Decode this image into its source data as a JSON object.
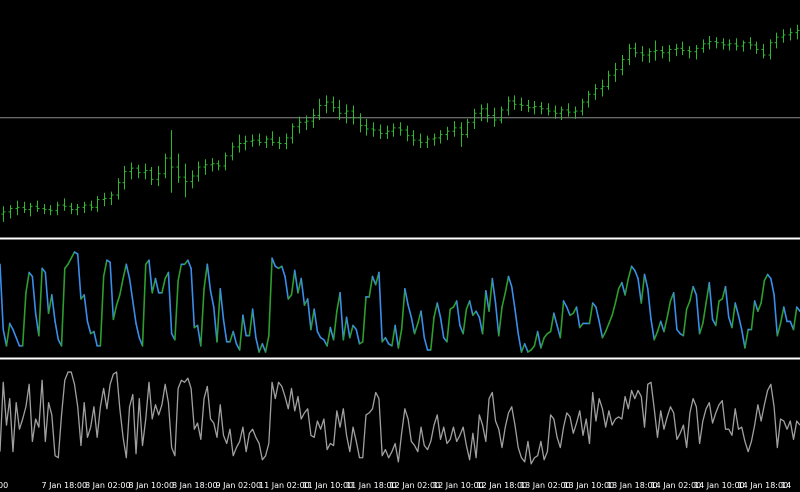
{
  "colors": {
    "background": "#000000",
    "bar_color": "#2eb82e",
    "indicator_up": "#2e9e2e",
    "indicator_down": "#3a8eea",
    "indicator2_line": "#a0a0a0",
    "level_line": "#8c8c8c",
    "separator": "#ffffff",
    "axis_text": "#ffffff"
  },
  "chart_data": [
    {
      "type": "ohlc",
      "panel": "price",
      "grid": false,
      "ylim": [
        0,
        100
      ],
      "horizontal_level": 51.0,
      "bars": [
        {
          "o": 8.0,
          "h": 11.5,
          "l": 4.5,
          "c": 9.0
        },
        {
          "o": 9.0,
          "h": 12.0,
          "l": 6.0,
          "c": 10.5
        },
        {
          "o": 10.5,
          "h": 14.0,
          "l": 7.5,
          "c": 11.0
        },
        {
          "o": 11.0,
          "h": 13.5,
          "l": 8.5,
          "c": 10.0
        },
        {
          "o": 10.0,
          "h": 13.0,
          "l": 7.0,
          "c": 11.5
        },
        {
          "o": 11.5,
          "h": 14.0,
          "l": 9.0,
          "c": 10.5
        },
        {
          "o": 10.5,
          "h": 12.5,
          "l": 8.0,
          "c": 10.0
        },
        {
          "o": 10.0,
          "h": 12.0,
          "l": 7.5,
          "c": 9.5
        },
        {
          "o": 9.5,
          "h": 13.5,
          "l": 7.5,
          "c": 12.0
        },
        {
          "o": 12.0,
          "h": 15.0,
          "l": 9.5,
          "c": 11.5
        },
        {
          "o": 11.5,
          "h": 13.0,
          "l": 8.0,
          "c": 10.0
        },
        {
          "o": 10.0,
          "h": 12.5,
          "l": 7.5,
          "c": 11.0
        },
        {
          "o": 11.0,
          "h": 13.5,
          "l": 8.5,
          "c": 12.0
        },
        {
          "o": 12.0,
          "h": 14.0,
          "l": 9.5,
          "c": 11.0
        },
        {
          "o": 11.0,
          "h": 16.0,
          "l": 9.0,
          "c": 14.5
        },
        {
          "o": 14.5,
          "h": 17.5,
          "l": 11.5,
          "c": 15.0
        },
        {
          "o": 15.0,
          "h": 18.0,
          "l": 12.0,
          "c": 16.5
        },
        {
          "o": 16.5,
          "h": 24.0,
          "l": 14.5,
          "c": 22.0
        },
        {
          "o": 22.0,
          "h": 29.5,
          "l": 19.0,
          "c": 27.0
        },
        {
          "o": 27.0,
          "h": 31.0,
          "l": 23.5,
          "c": 28.5
        },
        {
          "o": 28.5,
          "h": 30.0,
          "l": 24.0,
          "c": 26.5
        },
        {
          "o": 26.5,
          "h": 30.5,
          "l": 23.5,
          "c": 27.5
        },
        {
          "o": 27.5,
          "h": 29.0,
          "l": 21.0,
          "c": 23.5
        },
        {
          "o": 23.5,
          "h": 29.5,
          "l": 20.5,
          "c": 26.0
        },
        {
          "o": 26.0,
          "h": 35.0,
          "l": 24.0,
          "c": 33.0
        },
        {
          "o": 33.0,
          "h": 45.5,
          "l": 17.5,
          "c": 29.0
        },
        {
          "o": 29.0,
          "h": 35.0,
          "l": 22.0,
          "c": 24.5
        },
        {
          "o": 24.5,
          "h": 30.5,
          "l": 15.5,
          "c": 22.5
        },
        {
          "o": 22.5,
          "h": 27.5,
          "l": 19.5,
          "c": 25.0
        },
        {
          "o": 25.0,
          "h": 31.5,
          "l": 22.5,
          "c": 29.0
        },
        {
          "o": 29.0,
          "h": 32.5,
          "l": 25.5,
          "c": 30.0
        },
        {
          "o": 30.0,
          "h": 33.0,
          "l": 27.0,
          "c": 30.5
        },
        {
          "o": 30.5,
          "h": 32.0,
          "l": 27.5,
          "c": 29.5
        },
        {
          "o": 29.5,
          "h": 35.5,
          "l": 27.5,
          "c": 34.0
        },
        {
          "o": 34.0,
          "h": 40.0,
          "l": 32.0,
          "c": 38.0
        },
        {
          "o": 38.0,
          "h": 43.5,
          "l": 35.5,
          "c": 39.5
        },
        {
          "o": 39.5,
          "h": 43.0,
          "l": 36.5,
          "c": 40.5
        },
        {
          "o": 40.5,
          "h": 43.5,
          "l": 38.0,
          "c": 41.0
        },
        {
          "o": 41.0,
          "h": 44.0,
          "l": 38.5,
          "c": 40.0
        },
        {
          "o": 40.0,
          "h": 43.0,
          "l": 37.5,
          "c": 41.5
        },
        {
          "o": 41.5,
          "h": 45.0,
          "l": 38.5,
          "c": 40.0
        },
        {
          "o": 40.0,
          "h": 42.5,
          "l": 37.0,
          "c": 39.5
        },
        {
          "o": 39.5,
          "h": 44.0,
          "l": 37.0,
          "c": 42.0
        },
        {
          "o": 42.0,
          "h": 48.5,
          "l": 39.5,
          "c": 47.0
        },
        {
          "o": 47.0,
          "h": 51.5,
          "l": 44.0,
          "c": 49.0
        },
        {
          "o": 49.0,
          "h": 52.0,
          "l": 45.5,
          "c": 49.5
        },
        {
          "o": 49.5,
          "h": 55.0,
          "l": 46.5,
          "c": 52.0
        },
        {
          "o": 52.0,
          "h": 59.5,
          "l": 50.0,
          "c": 56.5
        },
        {
          "o": 56.5,
          "h": 61.0,
          "l": 53.0,
          "c": 58.0
        },
        {
          "o": 58.0,
          "h": 60.5,
          "l": 53.5,
          "c": 55.5
        },
        {
          "o": 55.5,
          "h": 59.0,
          "l": 50.0,
          "c": 53.0
        },
        {
          "o": 53.0,
          "h": 57.0,
          "l": 48.5,
          "c": 54.0
        },
        {
          "o": 54.0,
          "h": 56.5,
          "l": 48.0,
          "c": 51.0
        },
        {
          "o": 51.0,
          "h": 53.0,
          "l": 44.5,
          "c": 47.5
        },
        {
          "o": 47.5,
          "h": 50.5,
          "l": 43.0,
          "c": 46.0
        },
        {
          "o": 46.0,
          "h": 49.0,
          "l": 42.5,
          "c": 45.5
        },
        {
          "o": 45.5,
          "h": 48.0,
          "l": 41.5,
          "c": 44.0
        },
        {
          "o": 44.0,
          "h": 47.5,
          "l": 41.5,
          "c": 45.0
        },
        {
          "o": 45.0,
          "h": 48.5,
          "l": 42.5,
          "c": 46.5
        },
        {
          "o": 46.5,
          "h": 49.0,
          "l": 43.0,
          "c": 45.5
        },
        {
          "o": 45.5,
          "h": 47.5,
          "l": 40.5,
          "c": 43.0
        },
        {
          "o": 43.0,
          "h": 45.5,
          "l": 38.5,
          "c": 41.0
        },
        {
          "o": 41.0,
          "h": 44.0,
          "l": 37.5,
          "c": 40.0
        },
        {
          "o": 40.0,
          "h": 43.0,
          "l": 37.5,
          "c": 41.5
        },
        {
          "o": 41.5,
          "h": 44.0,
          "l": 38.5,
          "c": 42.0
        },
        {
          "o": 42.0,
          "h": 45.5,
          "l": 39.5,
          "c": 43.5
        },
        {
          "o": 43.5,
          "h": 47.0,
          "l": 41.0,
          "c": 45.0
        },
        {
          "o": 45.0,
          "h": 49.5,
          "l": 42.5,
          "c": 46.5
        },
        {
          "o": 46.5,
          "h": 49.0,
          "l": 38.0,
          "c": 43.5
        },
        {
          "o": 43.5,
          "h": 50.5,
          "l": 42.0,
          "c": 49.0
        },
        {
          "o": 49.0,
          "h": 55.0,
          "l": 46.0,
          "c": 53.0
        },
        {
          "o": 53.0,
          "h": 57.0,
          "l": 49.5,
          "c": 55.0
        },
        {
          "o": 55.0,
          "h": 57.5,
          "l": 49.0,
          "c": 52.0
        },
        {
          "o": 52.0,
          "h": 55.5,
          "l": 47.0,
          "c": 50.0
        },
        {
          "o": 50.0,
          "h": 56.0,
          "l": 48.5,
          "c": 54.5
        },
        {
          "o": 54.5,
          "h": 60.5,
          "l": 52.0,
          "c": 58.5
        },
        {
          "o": 58.5,
          "h": 61.0,
          "l": 54.5,
          "c": 57.0
        },
        {
          "o": 57.0,
          "h": 60.0,
          "l": 54.0,
          "c": 56.5
        },
        {
          "o": 56.5,
          "h": 59.0,
          "l": 53.5,
          "c": 55.5
        },
        {
          "o": 55.5,
          "h": 58.5,
          "l": 52.5,
          "c": 56.0
        },
        {
          "o": 56.0,
          "h": 58.0,
          "l": 52.5,
          "c": 55.0
        },
        {
          "o": 55.0,
          "h": 57.5,
          "l": 52.0,
          "c": 54.0
        },
        {
          "o": 54.0,
          "h": 56.5,
          "l": 50.5,
          "c": 53.0
        },
        {
          "o": 53.0,
          "h": 56.0,
          "l": 50.0,
          "c": 54.5
        },
        {
          "o": 54.5,
          "h": 57.5,
          "l": 51.5,
          "c": 53.5
        },
        {
          "o": 53.5,
          "h": 56.0,
          "l": 50.5,
          "c": 54.0
        },
        {
          "o": 54.0,
          "h": 59.5,
          "l": 52.0,
          "c": 58.0
        },
        {
          "o": 58.0,
          "h": 63.0,
          "l": 55.5,
          "c": 61.5
        },
        {
          "o": 61.5,
          "h": 66.0,
          "l": 59.0,
          "c": 64.0
        },
        {
          "o": 64.0,
          "h": 68.0,
          "l": 60.5,
          "c": 65.0
        },
        {
          "o": 65.0,
          "h": 72.0,
          "l": 63.5,
          "c": 70.0
        },
        {
          "o": 70.0,
          "h": 75.5,
          "l": 67.0,
          "c": 72.5
        },
        {
          "o": 72.5,
          "h": 79.0,
          "l": 70.0,
          "c": 77.0
        },
        {
          "o": 77.0,
          "h": 84.0,
          "l": 74.5,
          "c": 82.0
        },
        {
          "o": 82.0,
          "h": 84.5,
          "l": 78.0,
          "c": 80.0
        },
        {
          "o": 80.0,
          "h": 83.0,
          "l": 76.0,
          "c": 79.0
        },
        {
          "o": 79.0,
          "h": 82.0,
          "l": 75.5,
          "c": 80.5
        },
        {
          "o": 80.5,
          "h": 85.5,
          "l": 76.5,
          "c": 81.0
        },
        {
          "o": 81.0,
          "h": 83.0,
          "l": 77.5,
          "c": 80.0
        },
        {
          "o": 80.0,
          "h": 83.5,
          "l": 76.0,
          "c": 81.5
        },
        {
          "o": 81.5,
          "h": 84.0,
          "l": 78.5,
          "c": 82.0
        },
        {
          "o": 82.0,
          "h": 85.0,
          "l": 79.0,
          "c": 81.0
        },
        {
          "o": 81.0,
          "h": 83.0,
          "l": 77.5,
          "c": 80.5
        },
        {
          "o": 80.5,
          "h": 83.5,
          "l": 77.0,
          "c": 82.0
        },
        {
          "o": 82.0,
          "h": 86.0,
          "l": 80.0,
          "c": 84.0
        },
        {
          "o": 84.0,
          "h": 87.5,
          "l": 81.5,
          "c": 85.0
        },
        {
          "o": 85.0,
          "h": 87.0,
          "l": 82.0,
          "c": 84.5
        },
        {
          "o": 84.5,
          "h": 86.5,
          "l": 81.5,
          "c": 83.5
        },
        {
          "o": 83.5,
          "h": 86.0,
          "l": 81.0,
          "c": 84.0
        },
        {
          "o": 84.0,
          "h": 86.5,
          "l": 81.0,
          "c": 83.0
        },
        {
          "o": 83.0,
          "h": 85.5,
          "l": 80.5,
          "c": 84.5
        },
        {
          "o": 84.5,
          "h": 87.0,
          "l": 81.5,
          "c": 83.5
        },
        {
          "o": 83.5,
          "h": 85.0,
          "l": 79.5,
          "c": 81.5
        },
        {
          "o": 81.5,
          "h": 84.0,
          "l": 77.5,
          "c": 79.0
        },
        {
          "o": 79.0,
          "h": 86.0,
          "l": 77.0,
          "c": 84.5
        },
        {
          "o": 84.5,
          "h": 89.0,
          "l": 82.0,
          "c": 87.0
        },
        {
          "o": 87.0,
          "h": 90.5,
          "l": 84.5,
          "c": 88.0
        },
        {
          "o": 88.0,
          "h": 91.0,
          "l": 85.5,
          "c": 89.0
        },
        {
          "o": 89.0,
          "h": 92.5,
          "l": 86.0,
          "c": 90.0
        }
      ]
    },
    {
      "type": "line",
      "panel": "indicator",
      "ylim": [
        0,
        100
      ],
      "colored_by_direction": true,
      "values": [
        86,
        22,
        6,
        28,
        22,
        14,
        6,
        6,
        58,
        78,
        74,
        38,
        16,
        82,
        78,
        38,
        56,
        30,
        12,
        6,
        82,
        86,
        92,
        98,
        96,
        52,
        56,
        30,
        18,
        20,
        6,
        6,
        74,
        90,
        88,
        32,
        46,
        56,
        72,
        86,
        72,
        50,
        28,
        14,
        6,
        86,
        90,
        58,
        72,
        58,
        58,
        72,
        78,
        18,
        12,
        70,
        86,
        86,
        90,
        82,
        24,
        26,
        6,
        62,
        86,
        60,
        44,
        10,
        62,
        32,
        10,
        10,
        20,
        8,
        2,
        36,
        16,
        16,
        42,
        14,
        0,
        8,
        0,
        16,
        92,
        84,
        82,
        84,
        74,
        52,
        56,
        80,
        58,
        72,
        46,
        52,
        22,
        42,
        20,
        14,
        12,
        6,
        24,
        12,
        40,
        58,
        12,
        34,
        14,
        26,
        22,
        8,
        10,
        54,
        54,
        74,
        66,
        78,
        10,
        14,
        8,
        6,
        26,
        4,
        22,
        62,
        46,
        34,
        18,
        28,
        40,
        14,
        2,
        2,
        34,
        48,
        34,
        14,
        10,
        42,
        44,
        50,
        26,
        18,
        42,
        50,
        36,
        40,
        34,
        18,
        60,
        40,
        72,
        48,
        16,
        44,
        58,
        74,
        64,
        42,
        18,
        0,
        8,
        0,
        2,
        6,
        20,
        4,
        14,
        18,
        20,
        38,
        26,
        14,
        50,
        44,
        36,
        38,
        44,
        24,
        28,
        28,
        28,
        48,
        44,
        30,
        14,
        20,
        28,
        36,
        48,
        62,
        68,
        56,
        72,
        84,
        80,
        72,
        48,
        76,
        62,
        32,
        12,
        20,
        30,
        20,
        34,
        50,
        58,
        22,
        18,
        16,
        42,
        50,
        64,
        56,
        18,
        28,
        48,
        68,
        32,
        26,
        50,
        52,
        64,
        34,
        24,
        48,
        36,
        22,
        4,
        22,
        22,
        50,
        40,
        48,
        70,
        76,
        72,
        56,
        16,
        28,
        44,
        30,
        30,
        22,
        44,
        40
      ]
    },
    {
      "type": "line",
      "panel": "indicator2",
      "ylim": [
        0,
        100
      ],
      "values": [
        18,
        86,
        44,
        70,
        18,
        66,
        40,
        50,
        62,
        84,
        28,
        50,
        42,
        88,
        28,
        66,
        54,
        14,
        12,
        54,
        88,
        96,
        96,
        84,
        62,
        24,
        66,
        32,
        42,
        62,
        32,
        62,
        80,
        60,
        84,
        94,
        96,
        60,
        32,
        12,
        62,
        74,
        16,
        70,
        24,
        50,
        86,
        50,
        64,
        54,
        64,
        84,
        66,
        22,
        14,
        80,
        88,
        86,
        90,
        80,
        40,
        46,
        30,
        70,
        82,
        50,
        46,
        32,
        64,
        34,
        26,
        40,
        14,
        22,
        28,
        42,
        18,
        36,
        40,
        32,
        26,
        10,
        14,
        26,
        86,
        70,
        86,
        82,
        72,
        60,
        80,
        58,
        72,
        50,
        56,
        60,
        34,
        32,
        48,
        40,
        50,
        20,
        26,
        24,
        58,
        42,
        60,
        34,
        18,
        42,
        28,
        12,
        12,
        54,
        56,
        60,
        76,
        70,
        14,
        20,
        12,
        18,
        26,
        8,
        36,
        60,
        50,
        28,
        24,
        18,
        42,
        24,
        20,
        28,
        44,
        54,
        30,
        42,
        26,
        30,
        42,
        28,
        34,
        42,
        24,
        10,
        36,
        12,
        54,
        44,
        28,
        70,
        76,
        48,
        40,
        22,
        42,
        56,
        62,
        44,
        22,
        12,
        8,
        28,
        6,
        12,
        14,
        28,
        10,
        18,
        54,
        50,
        32,
        22,
        42,
        56,
        52,
        36,
        46,
        58,
        34,
        50,
        26,
        76,
        48,
        70,
        60,
        42,
        58,
        44,
        50,
        52,
        50,
        72,
        60,
        78,
        70,
        78,
        72,
        42,
        84,
        86,
        60,
        32,
        58,
        40,
        52,
        62,
        56,
        30,
        36,
        44,
        22,
        56,
        70,
        62,
        26,
        48,
        60,
        66,
        46,
        56,
        64,
        68,
        40,
        40,
        34,
        60,
        40,
        42,
        28,
        18,
        28,
        44,
        64,
        48,
        64,
        78,
        84,
        62,
        22,
        50,
        48,
        40,
        48,
        30,
        48,
        44
      ]
    },
    {
      "type": "axis",
      "panel": "time-axis",
      "tick_labels": [
        "00",
        "7 Jan 18:00",
        "8 Jan 02:00",
        "8 Jan 10:00",
        "8 Jan 18:00",
        "9 Jan 02:00",
        "11 Jan 02:00",
        "11 Jan 10:00",
        "11 Jan 18:00",
        "12 Jan 02:00",
        "12 Jan 10:00",
        "12 Jan 18:00",
        "13 Jan 02:00",
        "13 Jan 10:00",
        "13 Jan 18:00",
        "14 Jan 02:00",
        "14 Jan 10:00",
        "14 Jan 18:00",
        "14"
      ]
    }
  ]
}
